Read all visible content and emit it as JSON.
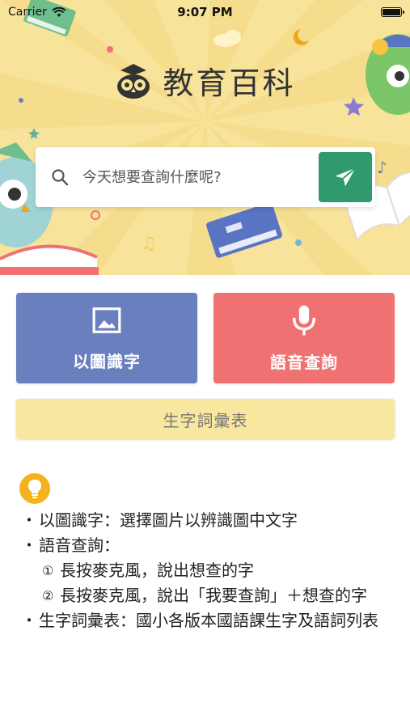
{
  "status_bar": {
    "carrier": "Carrier",
    "time": "9:07 PM"
  },
  "header": {
    "app_title": "教育百科"
  },
  "search": {
    "placeholder": "今天想要查詢什麼呢?"
  },
  "actions": {
    "image_label": "以圖識字",
    "voice_label": "語音查詢",
    "vocab_label": "生字詞彙表"
  },
  "help": {
    "item1": "以圖識字：選擇圖片以辨識圖中文字",
    "item2": "語音查詢：",
    "sub1_num": "①",
    "sub1": "長按麥克風，說出想查的字",
    "sub2_num": "②",
    "sub2": "長按麥克風，說出「我要查詢」＋想查的字",
    "item3": "生字詞彙表：國小各版本國語課生字及語詞列表",
    "bullet": "・"
  },
  "colors": {
    "hero_bg": "#f8e39a",
    "send_button": "#2f9a6b",
    "image_button": "#6a7fbd",
    "voice_button": "#f07172",
    "vocab_button": "#f8e79f",
    "bulb": "#f5b21c"
  },
  "icons": {
    "search": "search-icon",
    "send": "paper-plane-icon",
    "image": "image-icon",
    "mic": "microphone-icon",
    "bulb": "lightbulb-icon",
    "logo": "owl-logo-icon"
  }
}
